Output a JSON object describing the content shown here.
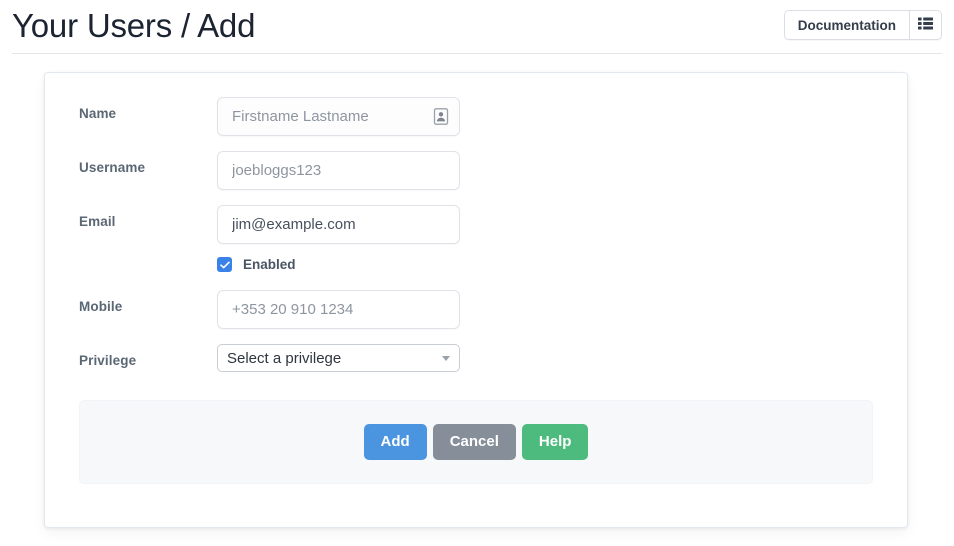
{
  "header": {
    "title": "Your Users / Add",
    "documentation_label": "Documentation",
    "list_icon": "list-icon"
  },
  "form": {
    "fields": [
      {
        "label": "Name",
        "type": "text",
        "value": "",
        "placeholder": "Firstname Lastname",
        "icon": "contact-card-icon",
        "name": "name"
      },
      {
        "label": "Username",
        "type": "text",
        "value": "",
        "placeholder": "joebloggs123",
        "name": "username"
      },
      {
        "label": "Email",
        "type": "text",
        "value": "jim@example.com",
        "placeholder": "",
        "name": "email"
      },
      {
        "label": "Mobile",
        "type": "text",
        "value": "",
        "placeholder": "+353 20 910 1234",
        "name": "mobile"
      }
    ],
    "enabled_checkbox": {
      "label": "Enabled",
      "checked": true
    },
    "privilege": {
      "label": "Privilege",
      "selected": "Select a privilege",
      "options": [
        "Select a privilege"
      ]
    }
  },
  "actions": {
    "add_label": "Add",
    "cancel_label": "Cancel",
    "help_label": "Help"
  },
  "colors": {
    "primary": "#4a94e0",
    "secondary": "#868e99",
    "success": "#4cbb7d",
    "checkbox": "#3b82e8",
    "label_text": "#5b6775",
    "panel_bg": "#f7f8fa"
  }
}
